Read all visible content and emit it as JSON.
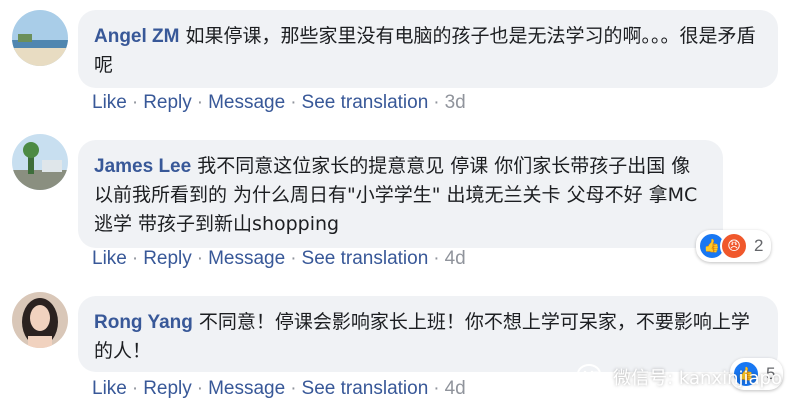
{
  "comments": [
    {
      "author": "Angel ZM",
      "text": "如果停课，那些家里没有电脑的孩子也是无法学习的啊。。。很是矛盾呢",
      "actions": {
        "like": "Like",
        "reply": "Reply",
        "message": "Message",
        "translate": "See translation",
        "time": "3d"
      }
    },
    {
      "author": "James Lee",
      "text": "我不同意这位家长的提意意见 停课 你们家长带孩子出国 像以前我所看到的 为什么周日有\"小学学生\" 出境无兰关卡 父母不好 拿MC逃学 带孩子到新山shopping",
      "actions": {
        "like": "Like",
        "reply": "Reply",
        "message": "Message",
        "translate": "See translation",
        "time": "4d"
      },
      "reactions": {
        "icons": [
          "like-icon",
          "angry-icon"
        ],
        "count": "2"
      }
    },
    {
      "author": "Rong Yang",
      "text": "不同意！停课会影响家长上班！你不想上学可呆家，不要影响上学的人！",
      "actions": {
        "like": "Like",
        "reply": "Reply",
        "message": "Message",
        "translate": "See translation",
        "time": "4d"
      },
      "reactions": {
        "icons": [
          "like-icon"
        ],
        "count": "5"
      }
    }
  ],
  "watermark": {
    "text": "微信号: kanxinjiapo",
    "icon": "wechat-icon"
  },
  "colors": {
    "link": "#385898",
    "bubble": "#f0f2f5",
    "text": "#1c1e21",
    "muted": "#90949c",
    "like": "#1877f2",
    "angry": "#f0582c"
  }
}
